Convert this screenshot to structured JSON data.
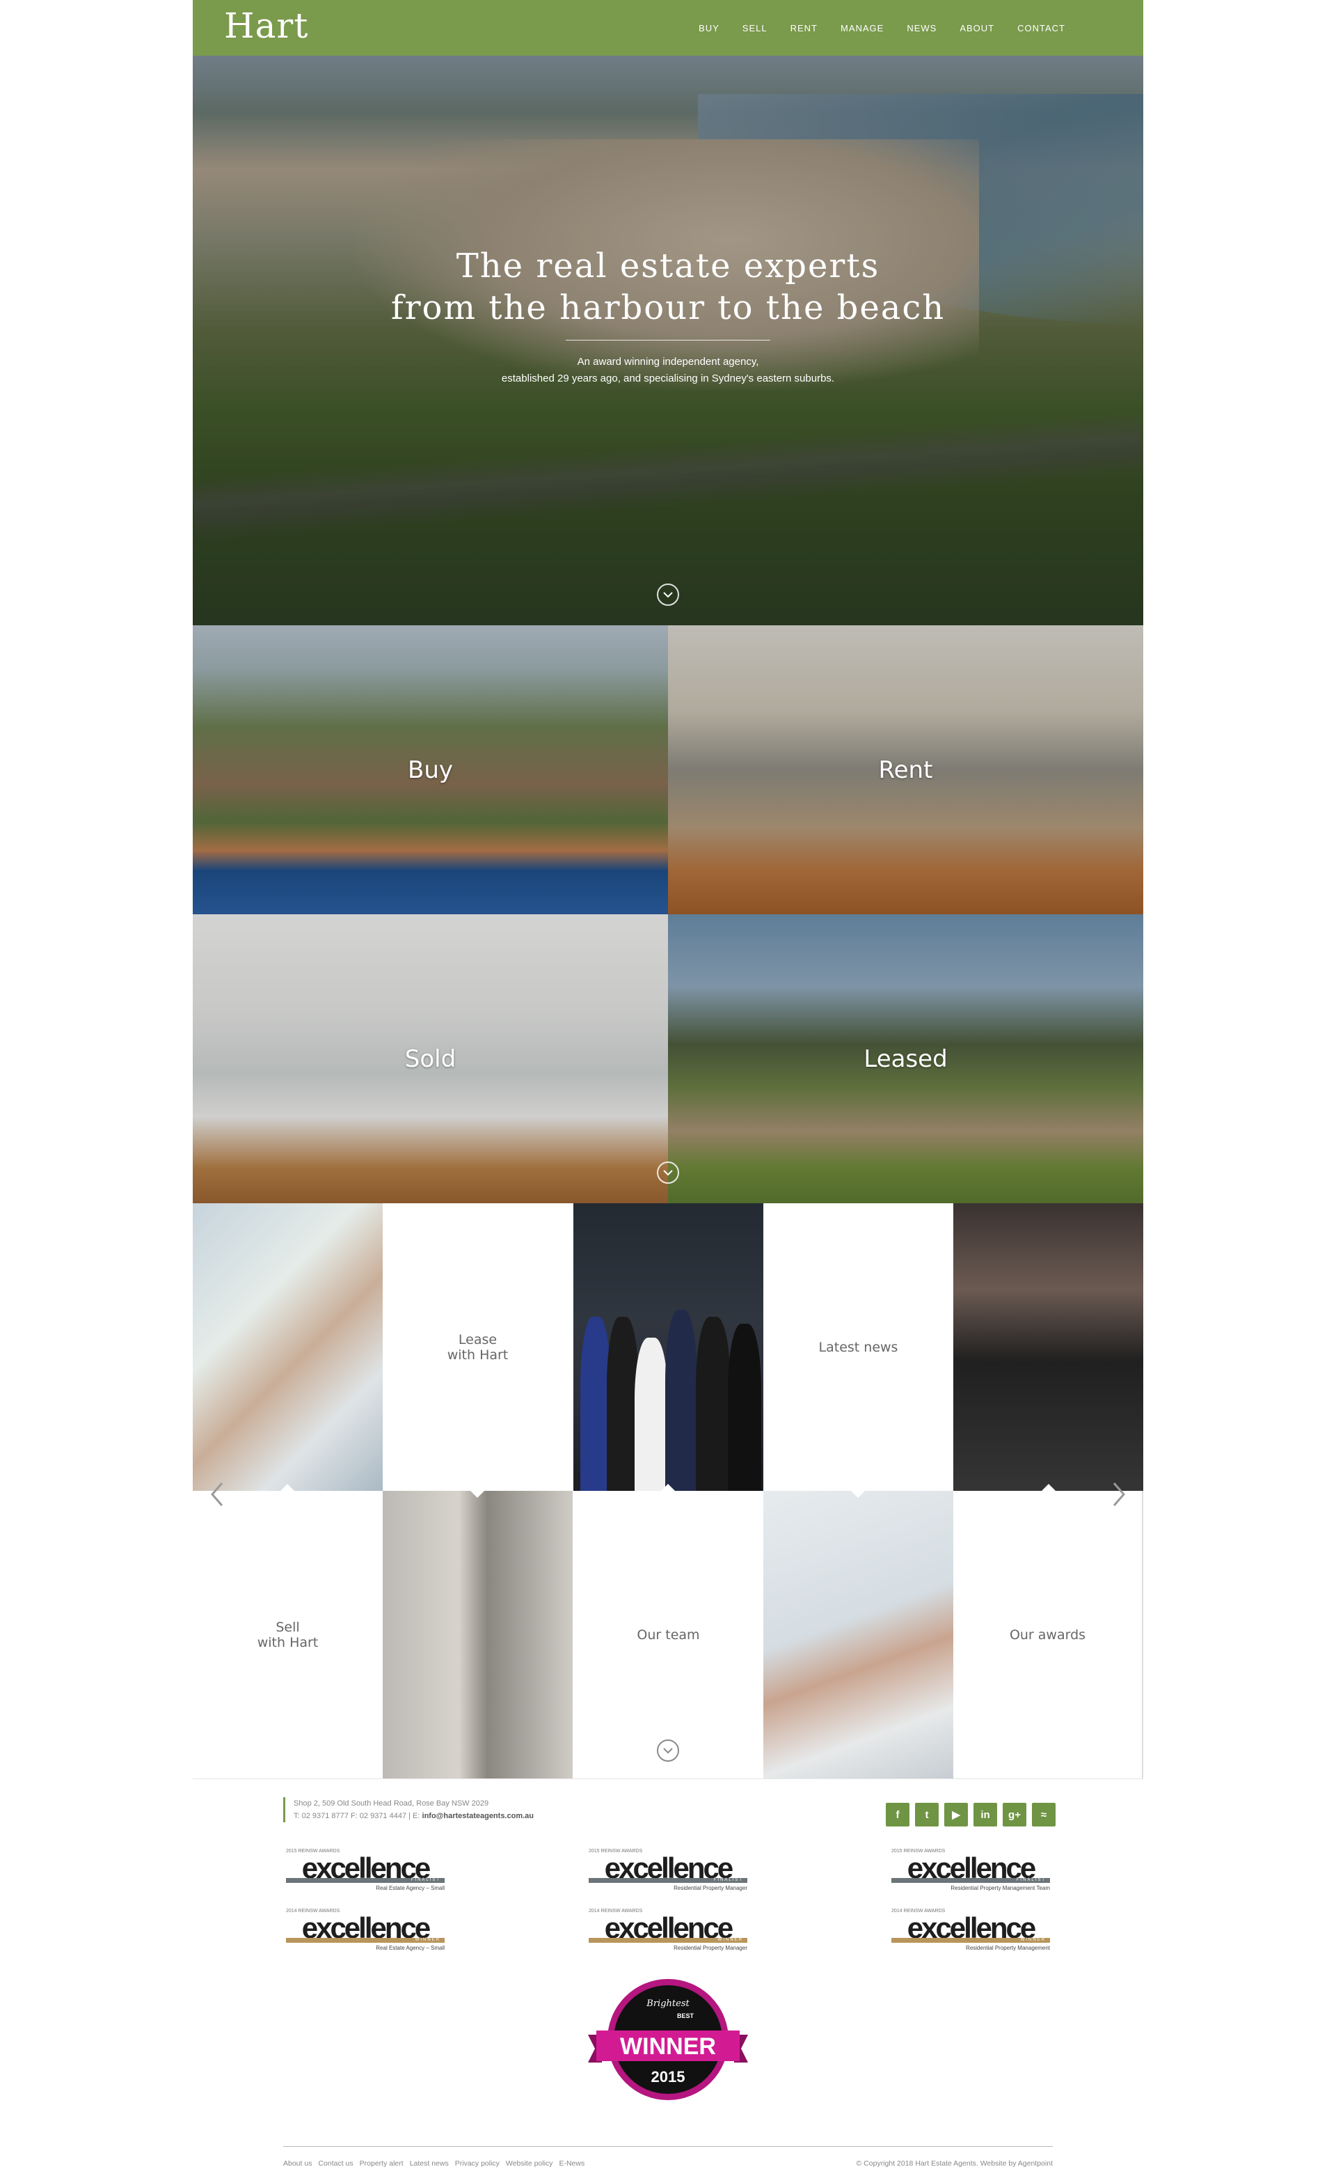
{
  "header": {
    "logo": "Hart",
    "nav": [
      "BUY",
      "SELL",
      "RENT",
      "MANAGE",
      "NEWS",
      "ABOUT",
      "CONTACT"
    ]
  },
  "hero": {
    "title_line1": "The real estate experts",
    "title_line2": "from the harbour to the beach",
    "sub_line1": "An award winning independent agency,",
    "sub_line2": "established 29 years ago, and specialising in Sydney's eastern suburbs."
  },
  "tiles": {
    "buy": "Buy",
    "rent": "Rent",
    "sold": "Sold",
    "leased": "Leased"
  },
  "grid": {
    "lease_line1": "Lease",
    "lease_line2": "with Hart",
    "latest_news": "Latest news",
    "sell_line1": "Sell",
    "sell_line2": "with Hart",
    "our_team": "Our team",
    "our_awards": "Our awards"
  },
  "footer": {
    "address": "Shop 2, 509 Old South Head Road, Rose Bay NSW 2029",
    "phone_line": "T: 02 9371 8777  F: 02 9371 4447 | E:",
    "email": "info@hartestateagents.com.au",
    "social_icons": [
      "facebook-icon",
      "twitter-icon",
      "youtube-icon",
      "linkedin-icon",
      "google-plus-icon",
      "rss-icon"
    ],
    "social_glyphs": [
      "f",
      "t",
      "▶",
      "in",
      "g+",
      "≈"
    ],
    "awards": [
      {
        "word": "excellence",
        "kind": "FINALIST",
        "category": "Real Estate Agency – Small",
        "year": "2015 REINSW AWARDS"
      },
      {
        "word": "excellence",
        "kind": "FINALIST",
        "category": "Residential Property Manager",
        "year": "2015 REINSW AWARDS"
      },
      {
        "word": "excellence",
        "kind": "FINALIST",
        "category": "Residential Property Management Team",
        "year": "2015 REINSW AWARDS"
      },
      {
        "word": "excellence",
        "kind": "WINNER",
        "category": "Real Estate Agency – Small",
        "year": "2014 REINSW AWARDS"
      },
      {
        "word": "excellence",
        "kind": "WINNER",
        "category": "Residential Property Manager",
        "year": "2014 REINSW AWARDS"
      },
      {
        "word": "excellence",
        "kind": "WINNER",
        "category": "Residential Property Management",
        "year": "2014 REINSW AWARDS"
      }
    ],
    "badge": {
      "top": "Brightest",
      "best": "BEST",
      "winner": "WINNER",
      "year": "2015"
    },
    "links": [
      "About us",
      "Contact us",
      "Property alert",
      "Latest news",
      "Privacy policy",
      "Website policy",
      "E-News"
    ],
    "copyright": "© Copyright 2018 Hart Estate Agents. Website by Agentpoint"
  },
  "colors": {
    "brand_green": "#7a9a4c",
    "social_green": "#6f9444",
    "finalist_bar": "#6b7478",
    "winner_bar": "#b8955a",
    "badge_magenta": "#b5167f"
  }
}
